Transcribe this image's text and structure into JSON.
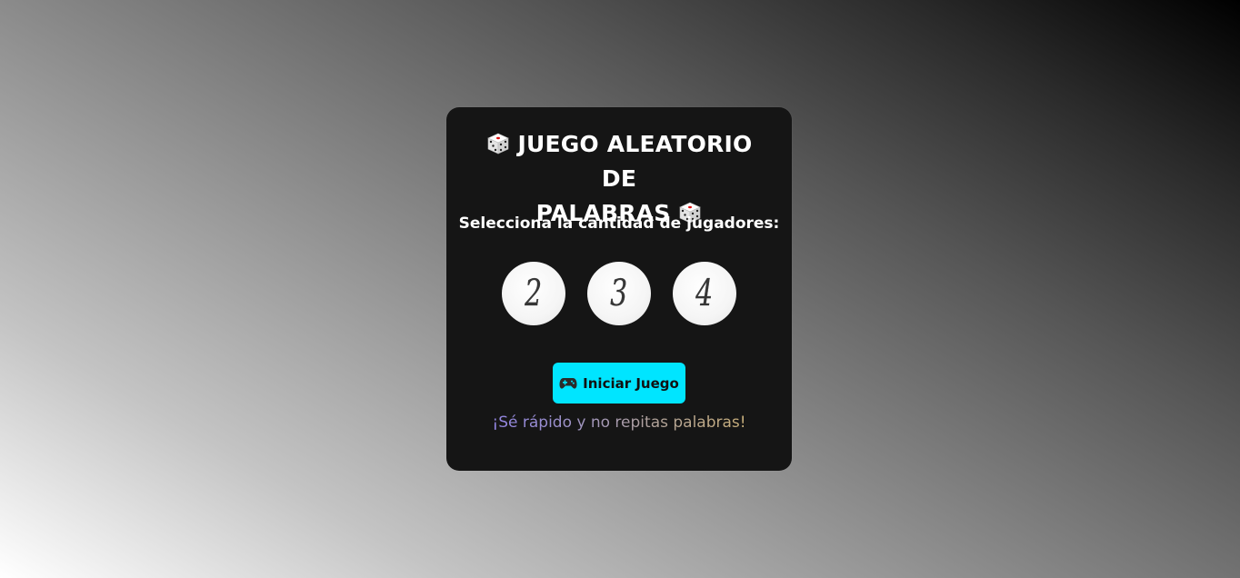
{
  "game": {
    "title": "JUEGO ALEATORIO DE PALABRAS",
    "title_line1": "JUEGO ALEATORIO DE",
    "title_line2": "PALABRAS",
    "title_icon": "die-icon",
    "subtitle": "Selecciona la cantidad de jugadores:",
    "player_options": [
      "2",
      "3",
      "4"
    ],
    "start_button": {
      "label": "Iniciar Juego",
      "icon": "gamepad-icon",
      "color": "#00e5ff"
    },
    "tagline": "¡Sé rápido y no repitas palabras!",
    "tagline_colors": [
      "#8b7cf0",
      "#d4b46a"
    ]
  },
  "colors": {
    "card_background": "#151515",
    "text": "#ffffff",
    "player_button": "#f5f5f5"
  }
}
